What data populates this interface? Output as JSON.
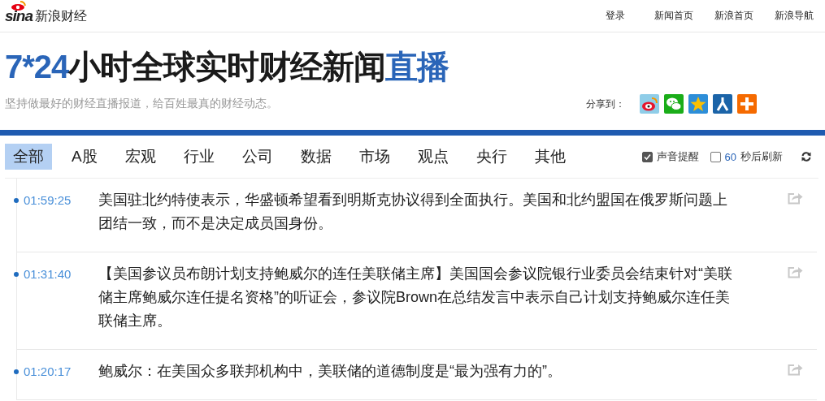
{
  "header": {
    "logo": {
      "mark": "sina",
      "name": "新浪财经"
    },
    "nav": [
      {
        "label": "登录"
      },
      {
        "label": "新闻首页"
      },
      {
        "label": "新浪首页"
      },
      {
        "label": "新浪导航"
      }
    ]
  },
  "headline": [
    {
      "text": "7*24",
      "accent": true
    },
    {
      "text": "小时全球实时财经新闻",
      "accent": false
    },
    {
      "text": "直播",
      "accent": true
    }
  ],
  "tagline": "坚持做最好的财经直播报道，给百姓最真的财经动态。",
  "share": {
    "label": "分享到：",
    "targets": [
      {
        "kind": "weibo"
      },
      {
        "kind": "wechat"
      },
      {
        "kind": "qzone"
      },
      {
        "kind": "renren"
      },
      {
        "kind": "more"
      }
    ]
  },
  "tabs": [
    {
      "label": "全部",
      "selected": true
    },
    {
      "label": "A股",
      "selected": false
    },
    {
      "label": "宏观",
      "selected": false
    },
    {
      "label": "行业",
      "selected": false
    },
    {
      "label": "公司",
      "selected": false
    },
    {
      "label": "数据",
      "selected": false
    },
    {
      "label": "市场",
      "selected": false
    },
    {
      "label": "观点",
      "selected": false
    },
    {
      "label": "央行",
      "selected": false
    },
    {
      "label": "其他",
      "selected": false
    }
  ],
  "options": {
    "sound": {
      "label": "声音提醒",
      "checked": true
    },
    "refresh": {
      "checked": false,
      "seconds": "60",
      "label": "秒后刷新"
    }
  },
  "news": [
    {
      "time": "01:59:25",
      "text": "美国驻北约特使表示，华盛顿希望看到明斯克协议得到全面执行。美国和北约盟国在俄罗斯问题上团结一致，而不是决定成员国身份。"
    },
    {
      "time": "01:31:40",
      "text": "【美国参议员布朗计划支持鲍威尔的连任美联储主席】美国国会参议院银行业委员会结束针对“美联储主席鲍威尔连任提名资格”的听证会，参议院Brown在总结发言中表示自己计划支持鲍威尔连任美联储主席。"
    },
    {
      "time": "01:20:17",
      "text": "鲍威尔：在美国众多联邦机构中，美联储的道德制度是“最为强有力的”。"
    }
  ]
}
